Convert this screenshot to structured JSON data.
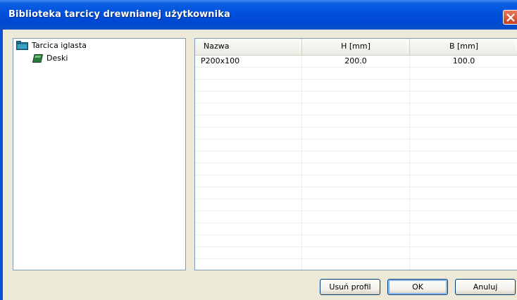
{
  "window": {
    "title": "Biblioteka tarcicy drewnianej użytkownika"
  },
  "tree": {
    "items": [
      {
        "label": "Tarcica iglasta",
        "icon": "folder-icon"
      },
      {
        "label": "Deski",
        "icon": "lumber-icon"
      }
    ]
  },
  "table": {
    "columns": [
      "Nazwa",
      "H [mm]",
      "B [mm]"
    ],
    "rows": [
      {
        "nazwa": "P200x100",
        "h": "200.0",
        "b": "100.0"
      }
    ]
  },
  "buttons": {
    "delete_label": "Usuń profil",
    "ok_label": "OK",
    "cancel_label": "Anuluj"
  },
  "colors": {
    "title_bar": "#0050dc",
    "dialog_bg": "#ece9d8",
    "close": "#c6401d"
  }
}
